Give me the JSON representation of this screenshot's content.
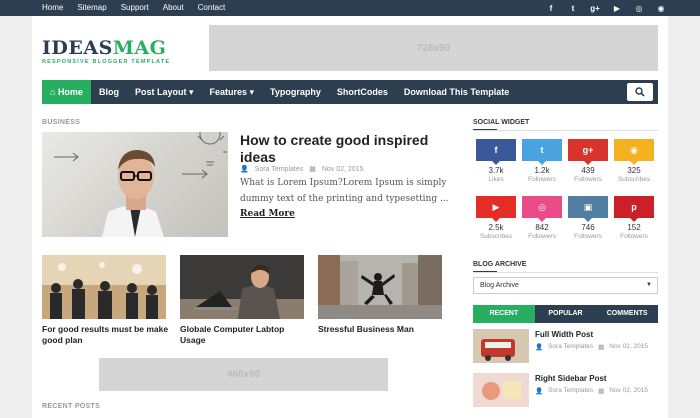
{
  "top_links": [
    "Home",
    "Sitemap",
    "Support",
    "About",
    "Contact"
  ],
  "top_social_icons": [
    "facebook-icon",
    "twitter-icon",
    "google-plus-icon",
    "youtube-icon",
    "dribbble-icon",
    "instagram-icon"
  ],
  "top_social_glyphs": [
    "f",
    "t",
    "g+",
    "▶",
    "◎",
    "◉"
  ],
  "logo": {
    "name_a": "IDEAS",
    "name_b": "MAG",
    "tagline": "RESPONSIVE BLOGGER TEMPLATE"
  },
  "ads": {
    "top": "728x90",
    "content": "468x60"
  },
  "nav": {
    "home": "Home",
    "items": [
      "Blog",
      "Post Layout ▾",
      "Features ▾",
      "Typography",
      "ShortCodes",
      "Download This Template"
    ]
  },
  "section": {
    "business": "BUSINESS",
    "recent_posts": "RECENT POSTS"
  },
  "featured": {
    "title": "How to create good inspired ideas",
    "author": "Sora Templates",
    "date": "Nov 02, 2015",
    "snippet": "What is Lorem Ipsum?Lorem Ipsum is simply dummy text of the printing and typesetting ...",
    "read_more": "Read More"
  },
  "thumbs": [
    {
      "title": "For good results must be make good plan"
    },
    {
      "title": "Globale Computer Labtop Usage"
    },
    {
      "title": "Stressful Business Man"
    }
  ],
  "sidebar": {
    "social_title": "SOCIAL WIDGET",
    "social": [
      {
        "icon": "facebook-icon",
        "glyph": "f",
        "count": "3.7k",
        "label": "Likes",
        "color": "#3b5998"
      },
      {
        "icon": "twitter-icon",
        "glyph": "t",
        "count": "1.2k",
        "label": "Followers",
        "color": "#4aa3df"
      },
      {
        "icon": "google-plus-icon",
        "glyph": "g+",
        "count": "439",
        "label": "Followers",
        "color": "#d9342b"
      },
      {
        "icon": "rss-icon",
        "glyph": "◉",
        "count": "325",
        "label": "Subscribes",
        "color": "#f5b120"
      },
      {
        "icon": "youtube-icon",
        "glyph": "▶",
        "count": "2.5k",
        "label": "Subscribes",
        "color": "#e52d27"
      },
      {
        "icon": "dribbble-icon",
        "glyph": "◎",
        "count": "842",
        "label": "Followers",
        "color": "#ea4c89"
      },
      {
        "icon": "instagram-icon",
        "glyph": "▣",
        "count": "746",
        "label": "Followers",
        "color": "#517fa4"
      },
      {
        "icon": "pinterest-icon",
        "glyph": "p",
        "count": "152",
        "label": "Followers",
        "color": "#cb2027"
      }
    ],
    "archive_title": "BLOG ARCHIVE",
    "archive_value": "Blog Archive",
    "tabs": [
      "RECENT",
      "POPULAR",
      "COMMENTS"
    ],
    "posts": [
      {
        "title": "Full Width Post",
        "author": "Sora Templates",
        "date": "Nov 02, 2015"
      },
      {
        "title": "Right Sidebar Post",
        "author": "Sora Templates",
        "date": "Nov 02, 2015"
      }
    ]
  }
}
